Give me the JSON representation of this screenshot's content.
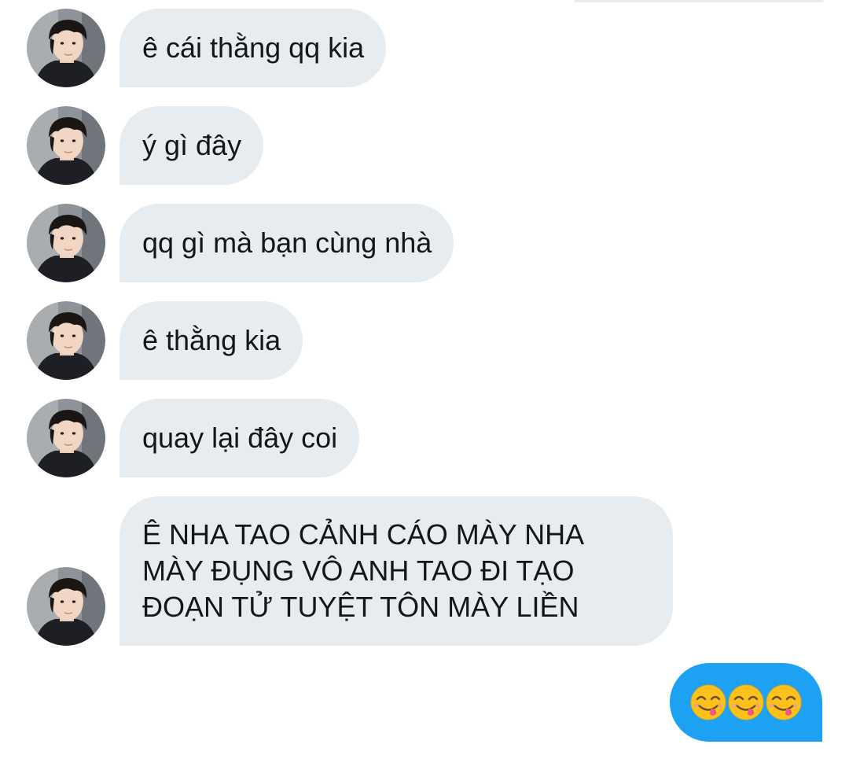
{
  "conversation": {
    "messages": [
      {
        "text": "ê cái thằng qq kia"
      },
      {
        "text": "ý gì đây"
      },
      {
        "text": "qq gì mà bạn cùng nhà"
      },
      {
        "text": "ê thằng kia"
      },
      {
        "text": "quay lại đây coi"
      },
      {
        "lines": [
          "Ê NHA TAO CẢNH CÁO MÀY NHA",
          "MÀY ĐỤNG VÔ ANH TAO ĐI TẠO",
          "ĐOẠN TỬ TUYỆT TÔN MÀY LIỀN"
        ]
      }
    ],
    "sent": {
      "emoji": [
        "face-savoring-food-emoji",
        "face-savoring-food-emoji",
        "face-savoring-food-emoji"
      ]
    }
  },
  "colors": {
    "received_bubble": "#e6ecf0",
    "sent_bubble": "#1da1f2",
    "text": "#14171a"
  }
}
